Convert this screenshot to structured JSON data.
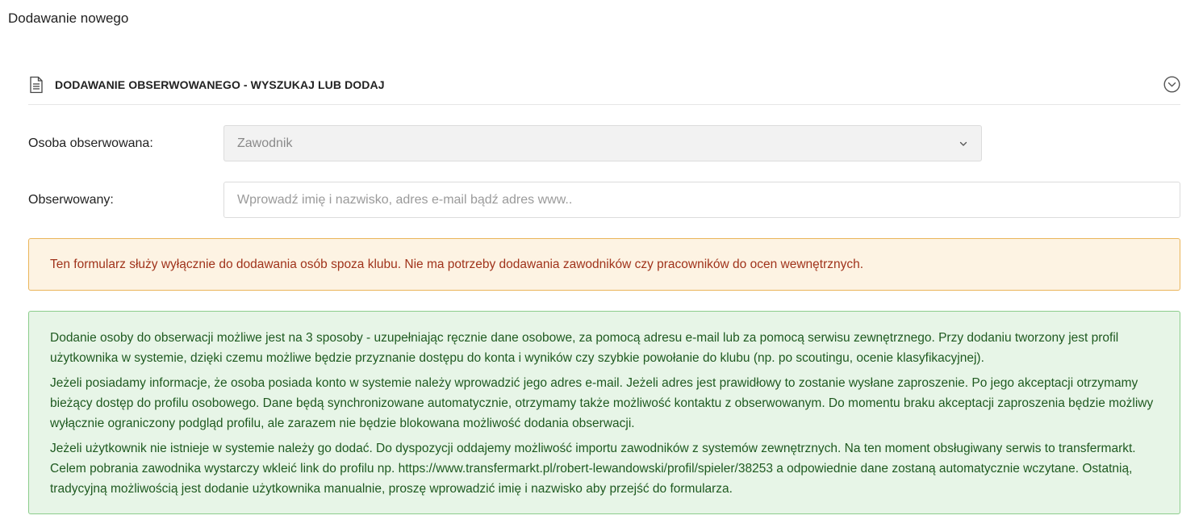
{
  "page": {
    "title": "Dodawanie nowego"
  },
  "section": {
    "title": "DODAWANIE OBSERWOWANEGO - WYSZUKAJ LUB DODAJ",
    "icon": "document-icon",
    "collapse_icon": "chevron-circle-down-icon"
  },
  "form": {
    "person_type": {
      "label": "Osoba obserwowana:",
      "selected": "Zawodnik"
    },
    "observed": {
      "label": "Obserwowany:",
      "value": "",
      "placeholder": "Wprowadź imię i nazwisko, adres e-mail bądź adres www.."
    }
  },
  "alerts": {
    "warning": "Ten formularz służy wyłącznie do dodawania osób spoza klubu. Nie ma potrzeby dodawania zawodników czy pracowników do ocen wewnętrznych.",
    "info_paragraphs": [
      "Dodanie osoby do obserwacji możliwe jest na 3 sposoby - uzupełniając ręcznie dane osobowe, za pomocą adresu e-mail lub za pomocą serwisu zewnętrznego. Przy dodaniu tworzony jest profil użytkownika w systemie, dzięki czemu możliwe będzie przyznanie dostępu do konta i wyników czy szybkie powołanie do klubu (np. po scoutingu, ocenie klasyfikacyjnej).",
      "Jeżeli posiadamy informacje, że osoba posiada konto w systemie należy wprowadzić jego adres e-mail. Jeżeli adres jest prawidłowy to zostanie wysłane zaproszenie. Po jego akceptacji otrzymamy bieżący dostęp do profilu osobowego. Dane będą synchronizowane automatycznie, otrzymamy także możliwość kontaktu z obserwowanym. Do momentu braku akceptacji zaproszenia będzie możliwy wyłącznie ograniczony podgląd profilu, ale zarazem nie będzie blokowana możliwość dodania obserwacji.",
      "Jeżeli użytkownik nie istnieje w systemie należy go dodać. Do dyspozycji oddajemy możliwość importu zawodników z systemów zewnętrznych. Na ten moment obsługiwany serwis to transfermarkt. Celem pobrania zawodnika wystarczy wkleić link do profilu np. https://www.transfermarkt.pl/robert-lewandowski/profil/spieler/38253 a odpowiednie dane zostaną automatycznie wczytane. Ostatnią, tradycyjną możliwością jest dodanie użytkownika manualnie, proszę wprowadzić imię i nazwisko aby przejść do formularza."
    ]
  },
  "colors": {
    "warning_bg": "#fdf3e3",
    "warning_border": "#eab55a",
    "warning_text": "#a0331b",
    "info_bg": "#e7f5e7",
    "info_border": "#8ccd8c",
    "info_text": "#1f5a20"
  }
}
